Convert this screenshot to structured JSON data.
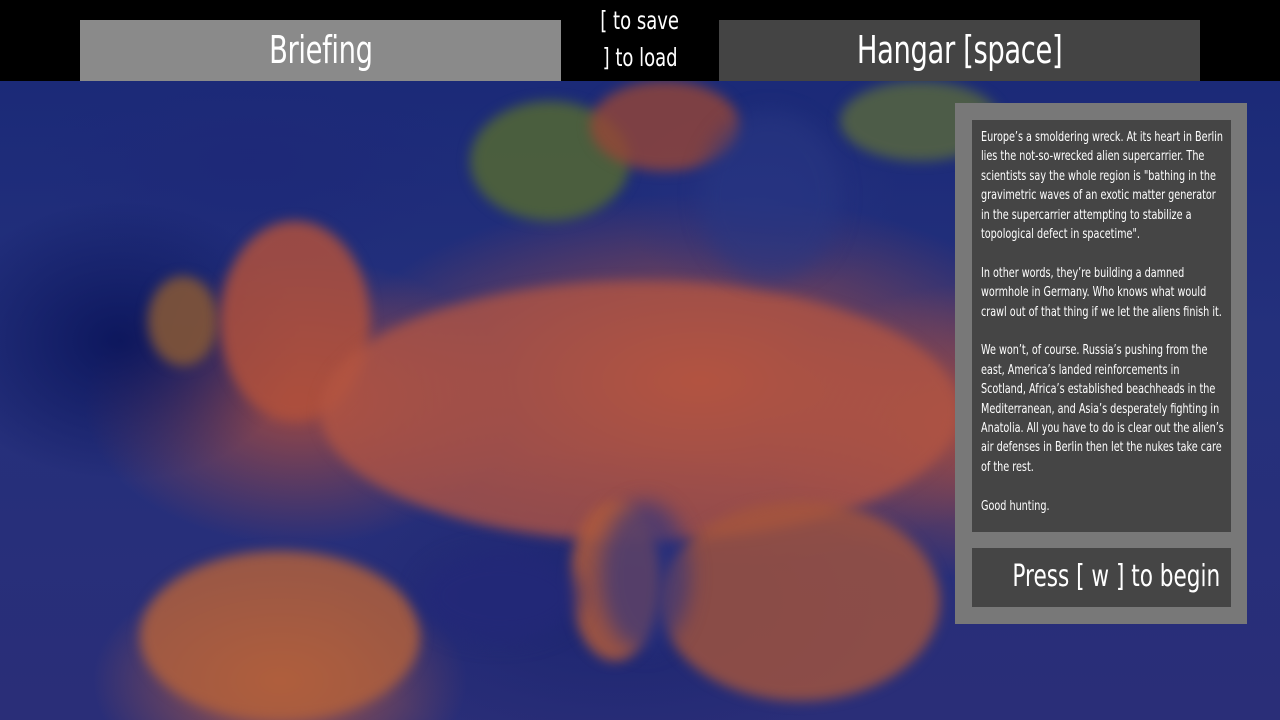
{
  "tabs": {
    "briefing_label": "Briefing",
    "hangar_label": "Hangar [space]"
  },
  "save_load": {
    "save_hint": "[ to save",
    "load_hint": "] to load"
  },
  "briefing": {
    "paragraphs": [
      "Europe’s a smoldering wreck. At its heart in Berlin lies the not-so-wrecked alien supercarrier. The scientists say the whole region is \"bathing in the gravimetric waves of an exotic matter generator in the supercarrier attempting to stabilize a topological defect in spacetime\".",
      "In other words, they’re building a damned wormhole in Germany. Who knows what would crawl out of that thing if we let the aliens finish it.",
      "We won’t, of course. Russia’s pushing from the east, America’s landed reinforcements in Scotland, Africa’s established beachheads in the Mediterranean, and Asia’s desperately fighting in Anatolia. All you have to do is clear out the alien’s air defenses in Berlin then let the nukes take care of the rest.",
      "Good hunting."
    ]
  },
  "begin_button_label": "Press [ w ] to begin",
  "colors": {
    "active_tab": "#8a8a8a",
    "inactive_tab": "#444444",
    "panel_frame": "#787878",
    "panel_box": "#454545"
  }
}
